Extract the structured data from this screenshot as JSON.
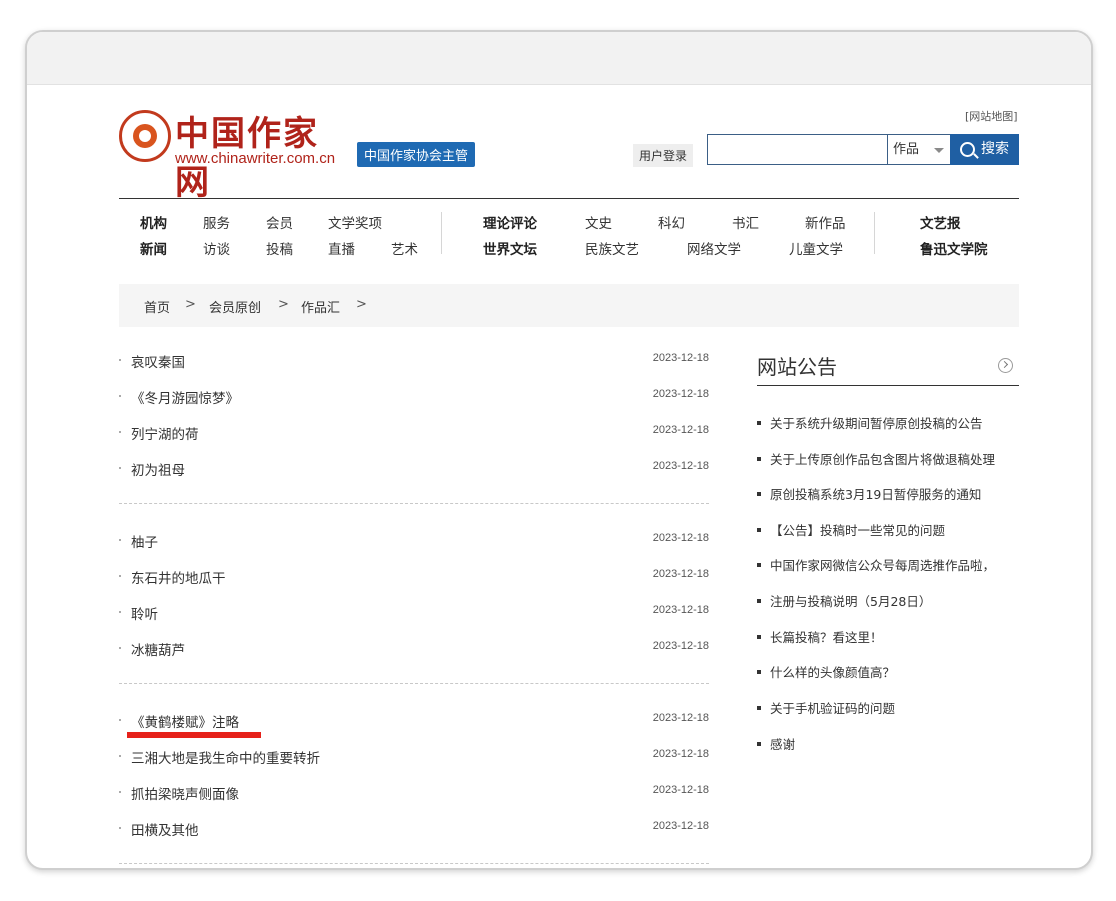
{
  "header": {
    "sitemap": "[网站地图]",
    "logo_cn": "中国作家网",
    "logo_url": "www.chinawriter.com.cn",
    "org_badge": "中国作家协会主管",
    "login": "用户登录",
    "search": {
      "value": "",
      "placeholder": "",
      "select_value": "作品",
      "button": "搜索"
    }
  },
  "nav": {
    "group1_row1": [
      "机构",
      "服务",
      "会员",
      "文学奖项"
    ],
    "group1_row2": [
      "新闻",
      "访谈",
      "投稿",
      "直播",
      "艺术"
    ],
    "group2_row1": [
      "理论评论",
      "文史",
      "科幻",
      "书汇",
      "新作品"
    ],
    "group2_row2": [
      "世界文坛",
      "民族文艺",
      "网络文学",
      "儿童文学"
    ],
    "group3": [
      "文艺报",
      "鲁迅文学院"
    ]
  },
  "breadcrumb": [
    "首页",
    "会员原创",
    "作品汇"
  ],
  "breadcrumb_sep": ">",
  "articles": [
    {
      "title": "哀叹秦国",
      "date": "2023-12-18"
    },
    {
      "title": "《冬月游园惊梦》",
      "date": "2023-12-18"
    },
    {
      "title": "列宁湖的荷",
      "date": "2023-12-18"
    },
    {
      "title": "初为祖母",
      "date": "2023-12-18"
    },
    {
      "title": "柚子",
      "date": "2023-12-18"
    },
    {
      "title": "东石井的地瓜干",
      "date": "2023-12-18"
    },
    {
      "title": "聆听",
      "date": "2023-12-18"
    },
    {
      "title": "冰糖葫芦",
      "date": "2023-12-18"
    },
    {
      "title": "《黄鹤楼赋》注略",
      "date": "2023-12-18"
    },
    {
      "title": "三湘大地是我生命中的重要转折",
      "date": "2023-12-18"
    },
    {
      "title": "抓拍梁晓声侧面像",
      "date": "2023-12-18"
    },
    {
      "title": "田横及其他",
      "date": "2023-12-18"
    }
  ],
  "notices": {
    "title": "网站公告",
    "items": [
      "关于系统升级期间暂停原创投稿的公告",
      "关于上传原创作品包含图片将做退稿处理",
      "原创投稿系统3月19日暂停服务的通知",
      "【公告】投稿时一些常见的问题",
      "中国作家网微信公众号每周选推作品啦，",
      "注册与投稿说明（5月28日）",
      "长篇投稿？看这里！",
      "什么样的头像颜值高？",
      "关于手机验证码的问题",
      "感谢"
    ]
  },
  "colors": {
    "brand_red": "#b0231a",
    "blue": "#1f5fa3",
    "highlight": "#e6211a"
  }
}
